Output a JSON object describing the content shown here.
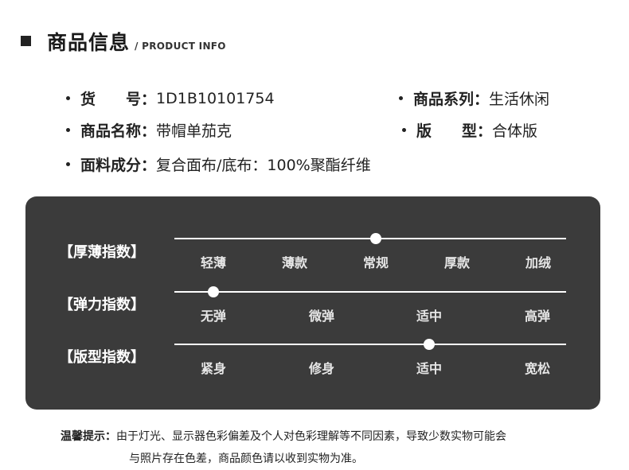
{
  "header": {
    "title": "商品信息",
    "subtitle": "/ PRODUCT INFO"
  },
  "info": {
    "item_no": {
      "label": "货　　号：",
      "value": "1D1B10101754"
    },
    "series": {
      "label": "商品系列：",
      "value": "生活休闲"
    },
    "name": {
      "label": "商品名称：",
      "value": "带帽单茄克"
    },
    "fit": {
      "label": "版　　型：",
      "value": "合体版"
    },
    "fabric": {
      "label": "面料成分：",
      "value": "复合面布/底布：100%聚酯纤维"
    }
  },
  "indices": [
    {
      "label": "【厚薄指数】",
      "options": [
        "轻薄",
        "薄款",
        "常规",
        "厚款",
        "加绒"
      ],
      "selected": 2
    },
    {
      "label": "【弹力指数】",
      "options": [
        "无弹",
        "微弹",
        "适中",
        "高弹"
      ],
      "selected": 0
    },
    {
      "label": "【版型指数】",
      "options": [
        "紧身",
        "修身",
        "适中",
        "宽松"
      ],
      "selected": 2
    }
  ],
  "note": {
    "label": "温馨提示：",
    "line1": "由于灯光、显示器色彩偏差及个人对色彩理解等不同因素，导致少数实物可能会",
    "line2": "与照片存在色差，商品颜色请以收到实物为准。"
  }
}
